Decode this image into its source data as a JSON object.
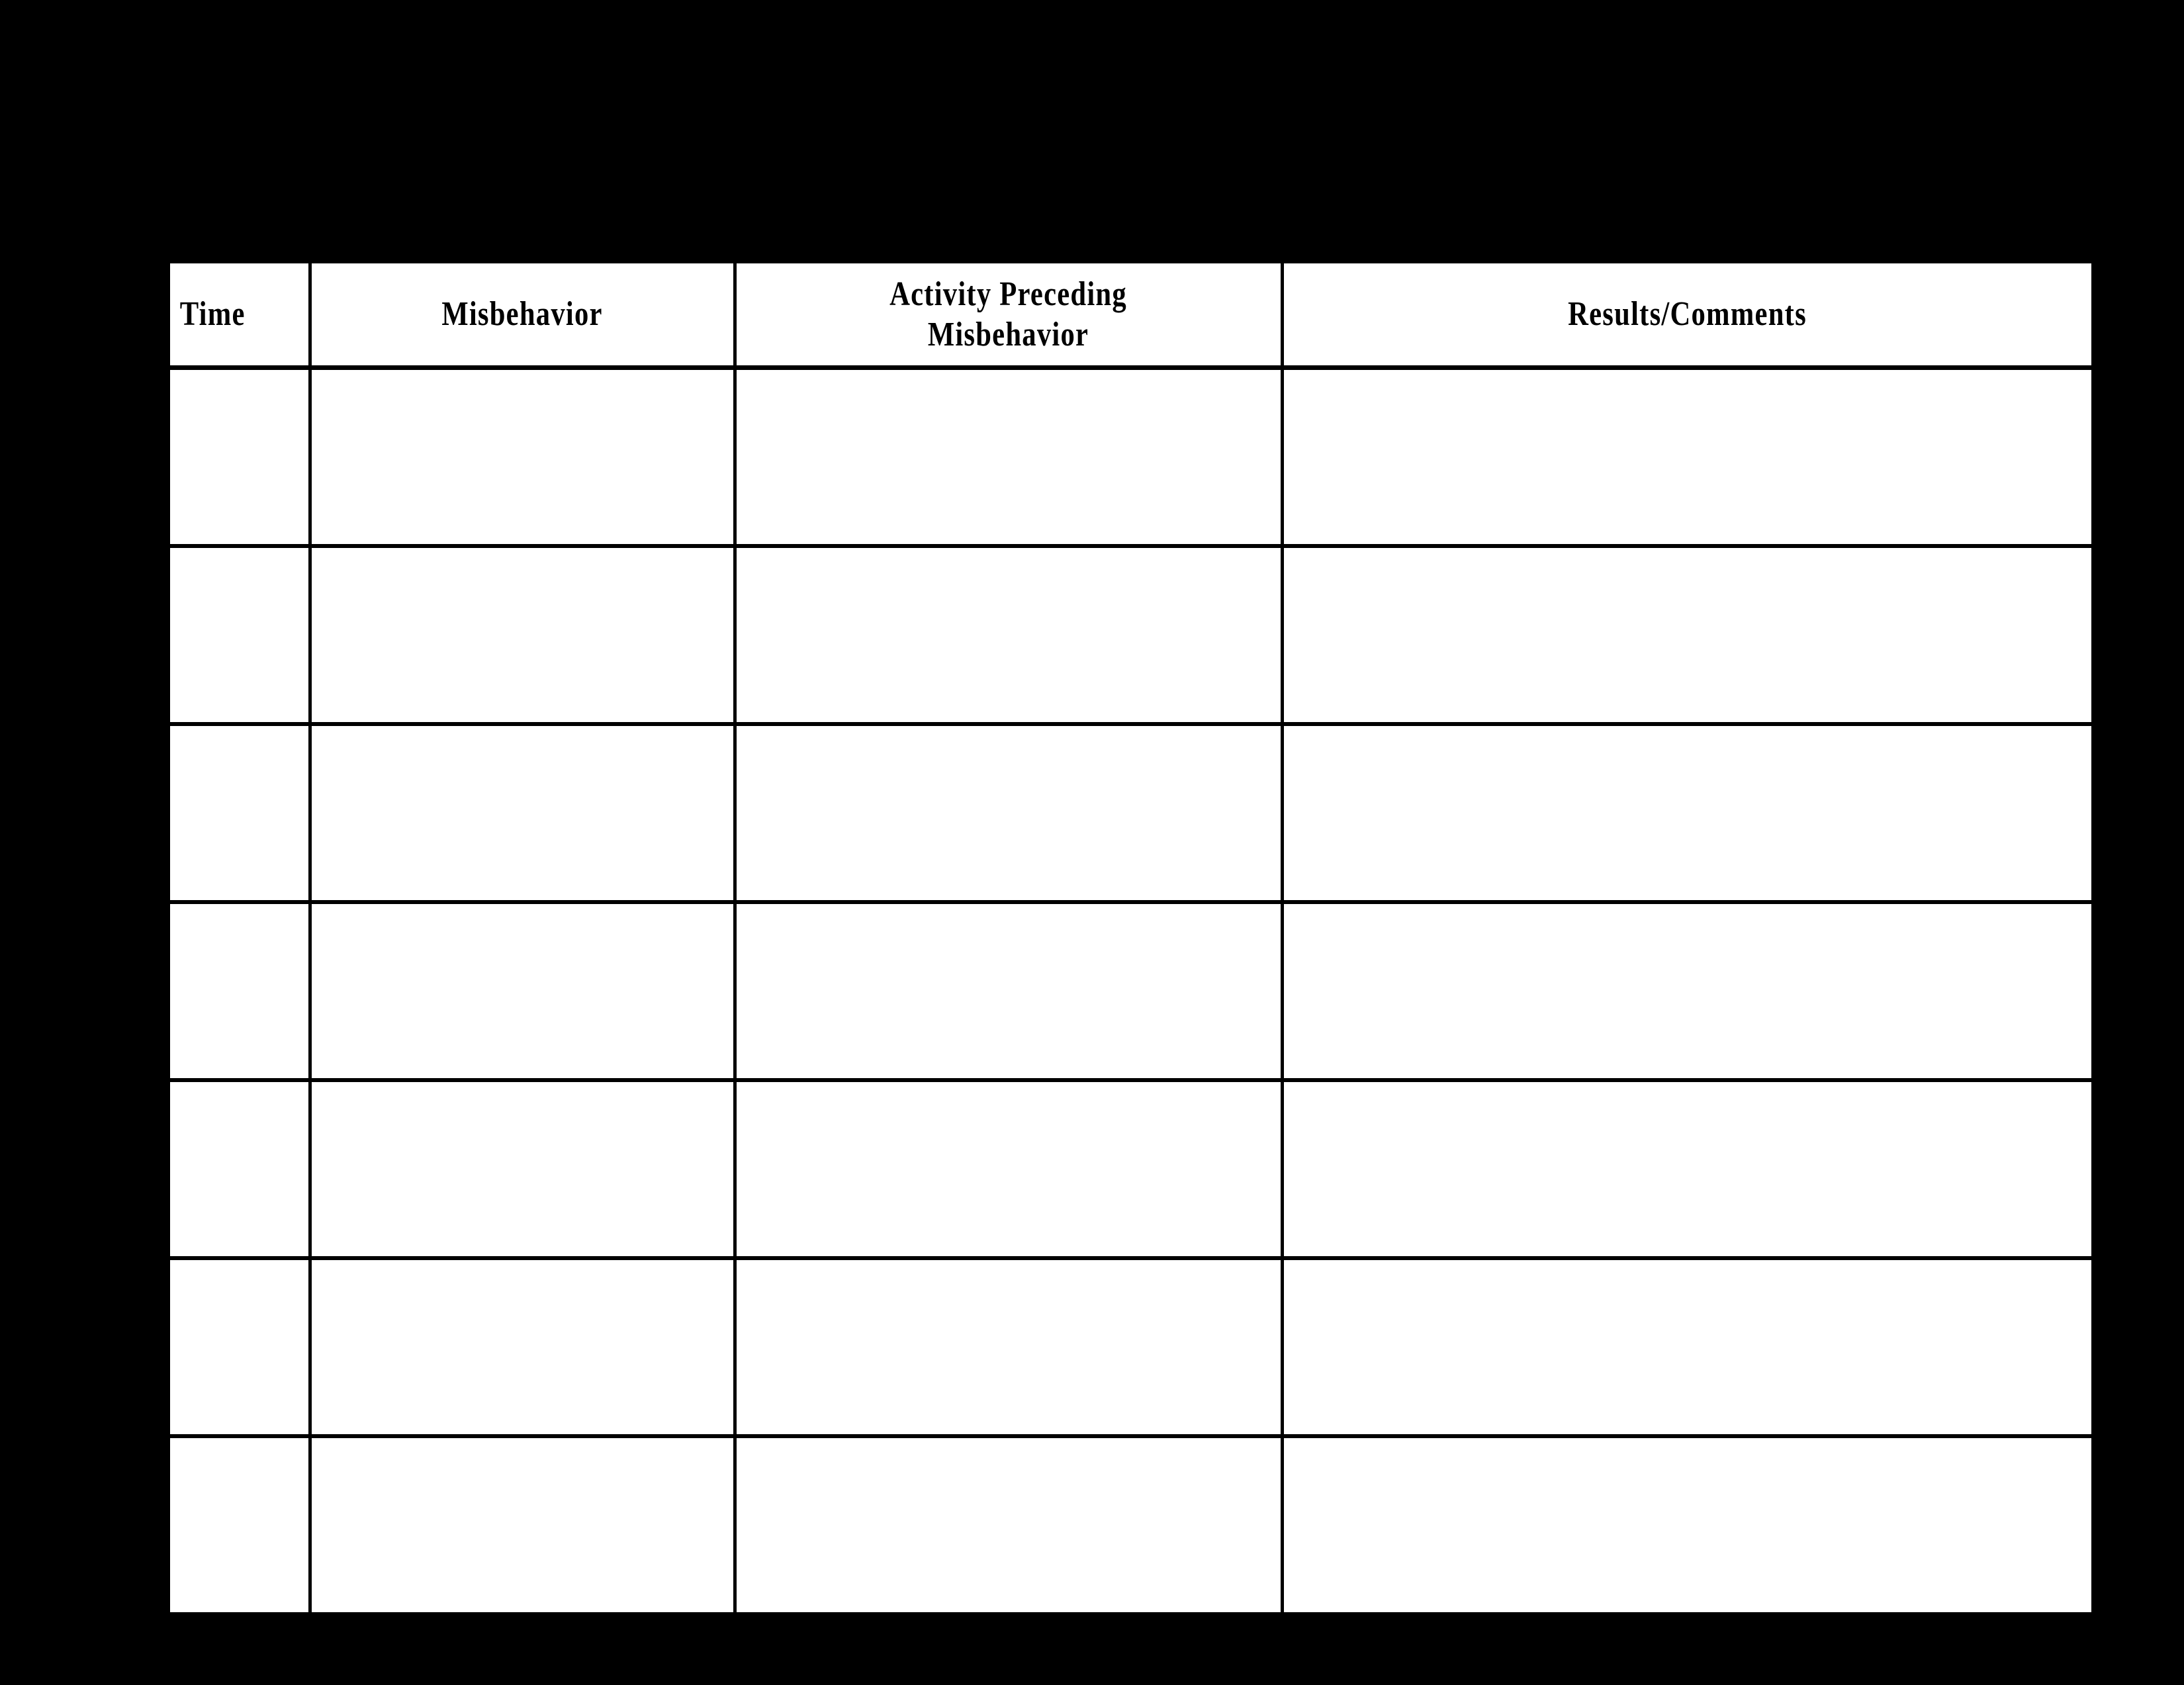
{
  "document": {
    "type": "behavior-log-table",
    "background_color": "#000000",
    "cell_color": "#ffffff",
    "border_color": "#000000"
  },
  "table": {
    "columns": [
      {
        "key": "time",
        "header_lines": [
          "Time"
        ],
        "align": "left"
      },
      {
        "key": "misbehavior",
        "header_lines": [
          "Misbehavior"
        ],
        "align": "center"
      },
      {
        "key": "activity",
        "header_lines": [
          "Activity Preceding",
          "Misbehavior"
        ],
        "align": "center"
      },
      {
        "key": "results",
        "header_lines": [
          "Results/Comments"
        ],
        "align": "center"
      }
    ],
    "row_count": 7,
    "rows": [
      {
        "time": "",
        "misbehavior": "",
        "activity": "",
        "results": ""
      },
      {
        "time": "",
        "misbehavior": "",
        "activity": "",
        "results": ""
      },
      {
        "time": "",
        "misbehavior": "",
        "activity": "",
        "results": ""
      },
      {
        "time": "",
        "misbehavior": "",
        "activity": "",
        "results": ""
      },
      {
        "time": "",
        "misbehavior": "",
        "activity": "",
        "results": ""
      },
      {
        "time": "",
        "misbehavior": "",
        "activity": "",
        "results": ""
      },
      {
        "time": "",
        "misbehavior": "",
        "activity": "",
        "results": ""
      }
    ]
  }
}
